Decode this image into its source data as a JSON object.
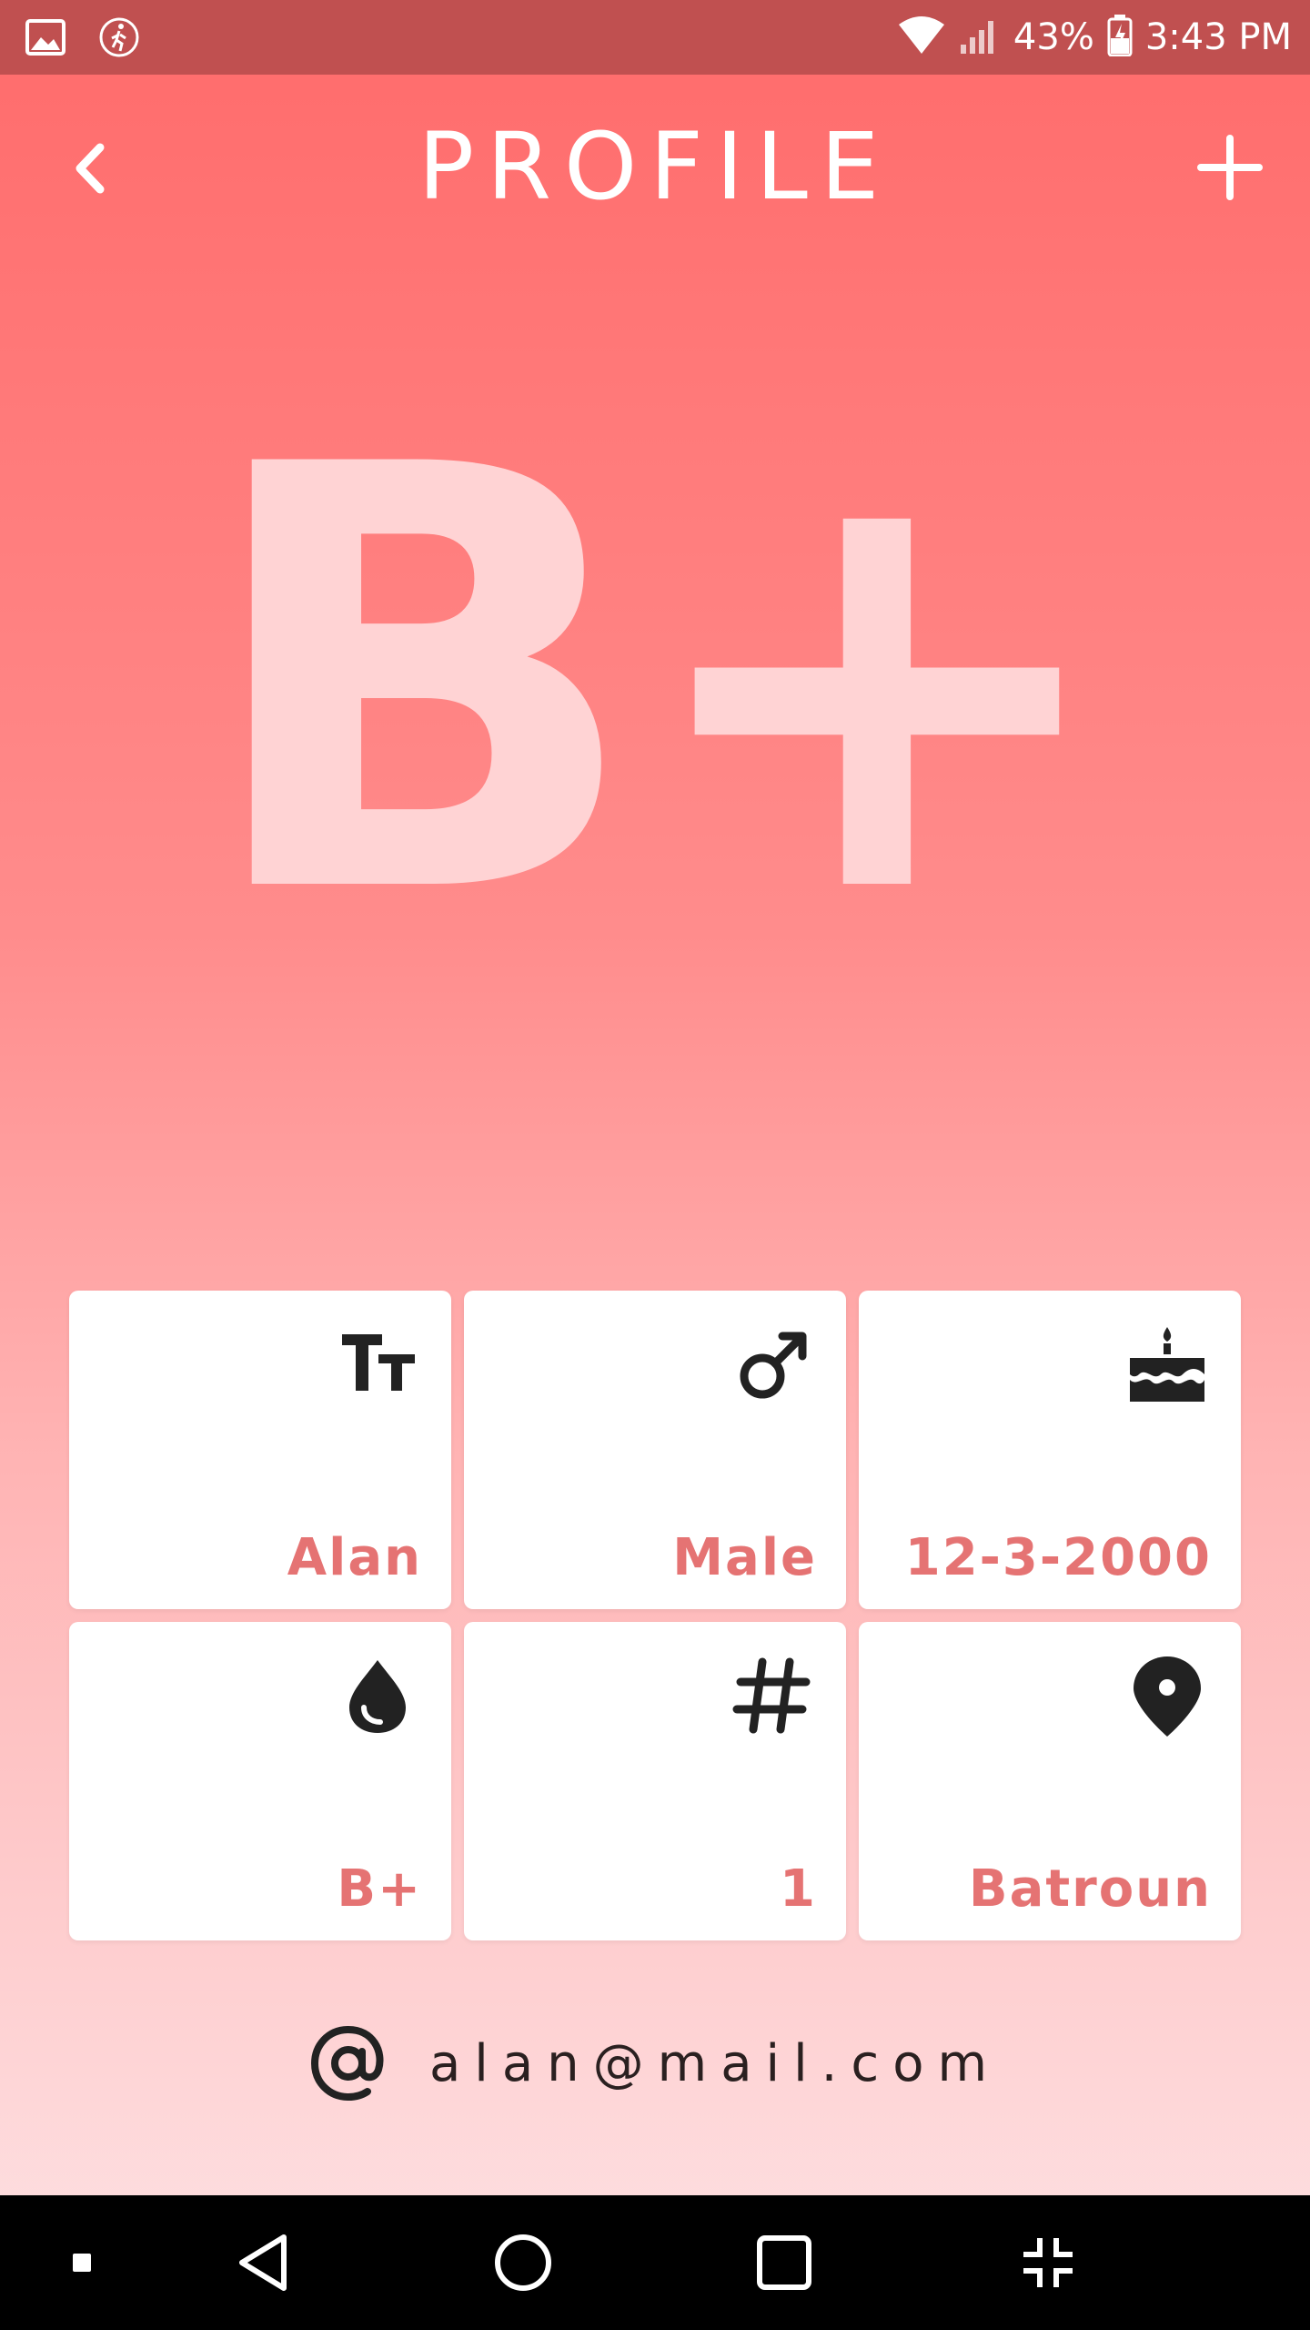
{
  "status_bar": {
    "battery": "43%",
    "time": "3:43 PM",
    "icons": [
      "image-icon",
      "walking-icon",
      "wifi-icon",
      "signal-icon",
      "battery-charging-icon"
    ]
  },
  "header": {
    "title": "PROFILE",
    "back_icon": "chevron-left-icon",
    "add_icon": "plus-icon"
  },
  "blood_type_display": "B+",
  "cards": [
    {
      "name": "name",
      "icon": "text-size-icon",
      "value": "Alan"
    },
    {
      "name": "gender",
      "icon": "male-icon",
      "value": "Male"
    },
    {
      "name": "birthday",
      "icon": "birthday-cake-icon",
      "value": "12-3-2000"
    },
    {
      "name": "blood-type",
      "icon": "blood-drop-icon",
      "value": "B+"
    },
    {
      "name": "number",
      "icon": "hash-icon",
      "value": "1"
    },
    {
      "name": "location",
      "icon": "map-pin-icon",
      "value": "Batroun"
    }
  ],
  "email": {
    "icon": "at-sign-icon",
    "value": "alan@mail.com"
  },
  "nav_bar": {
    "icons": [
      "square-dot-icon",
      "back-triangle-icon",
      "home-circle-icon",
      "recents-square-icon",
      "collapse-icon"
    ]
  },
  "colors": {
    "accent": "#e57373",
    "status_bar": "#c05050",
    "gradient_top": "#ff6b6b",
    "gradient_bottom": "#fde3e5",
    "big_text": "#ffd3d4",
    "icon_dark": "#222222"
  }
}
